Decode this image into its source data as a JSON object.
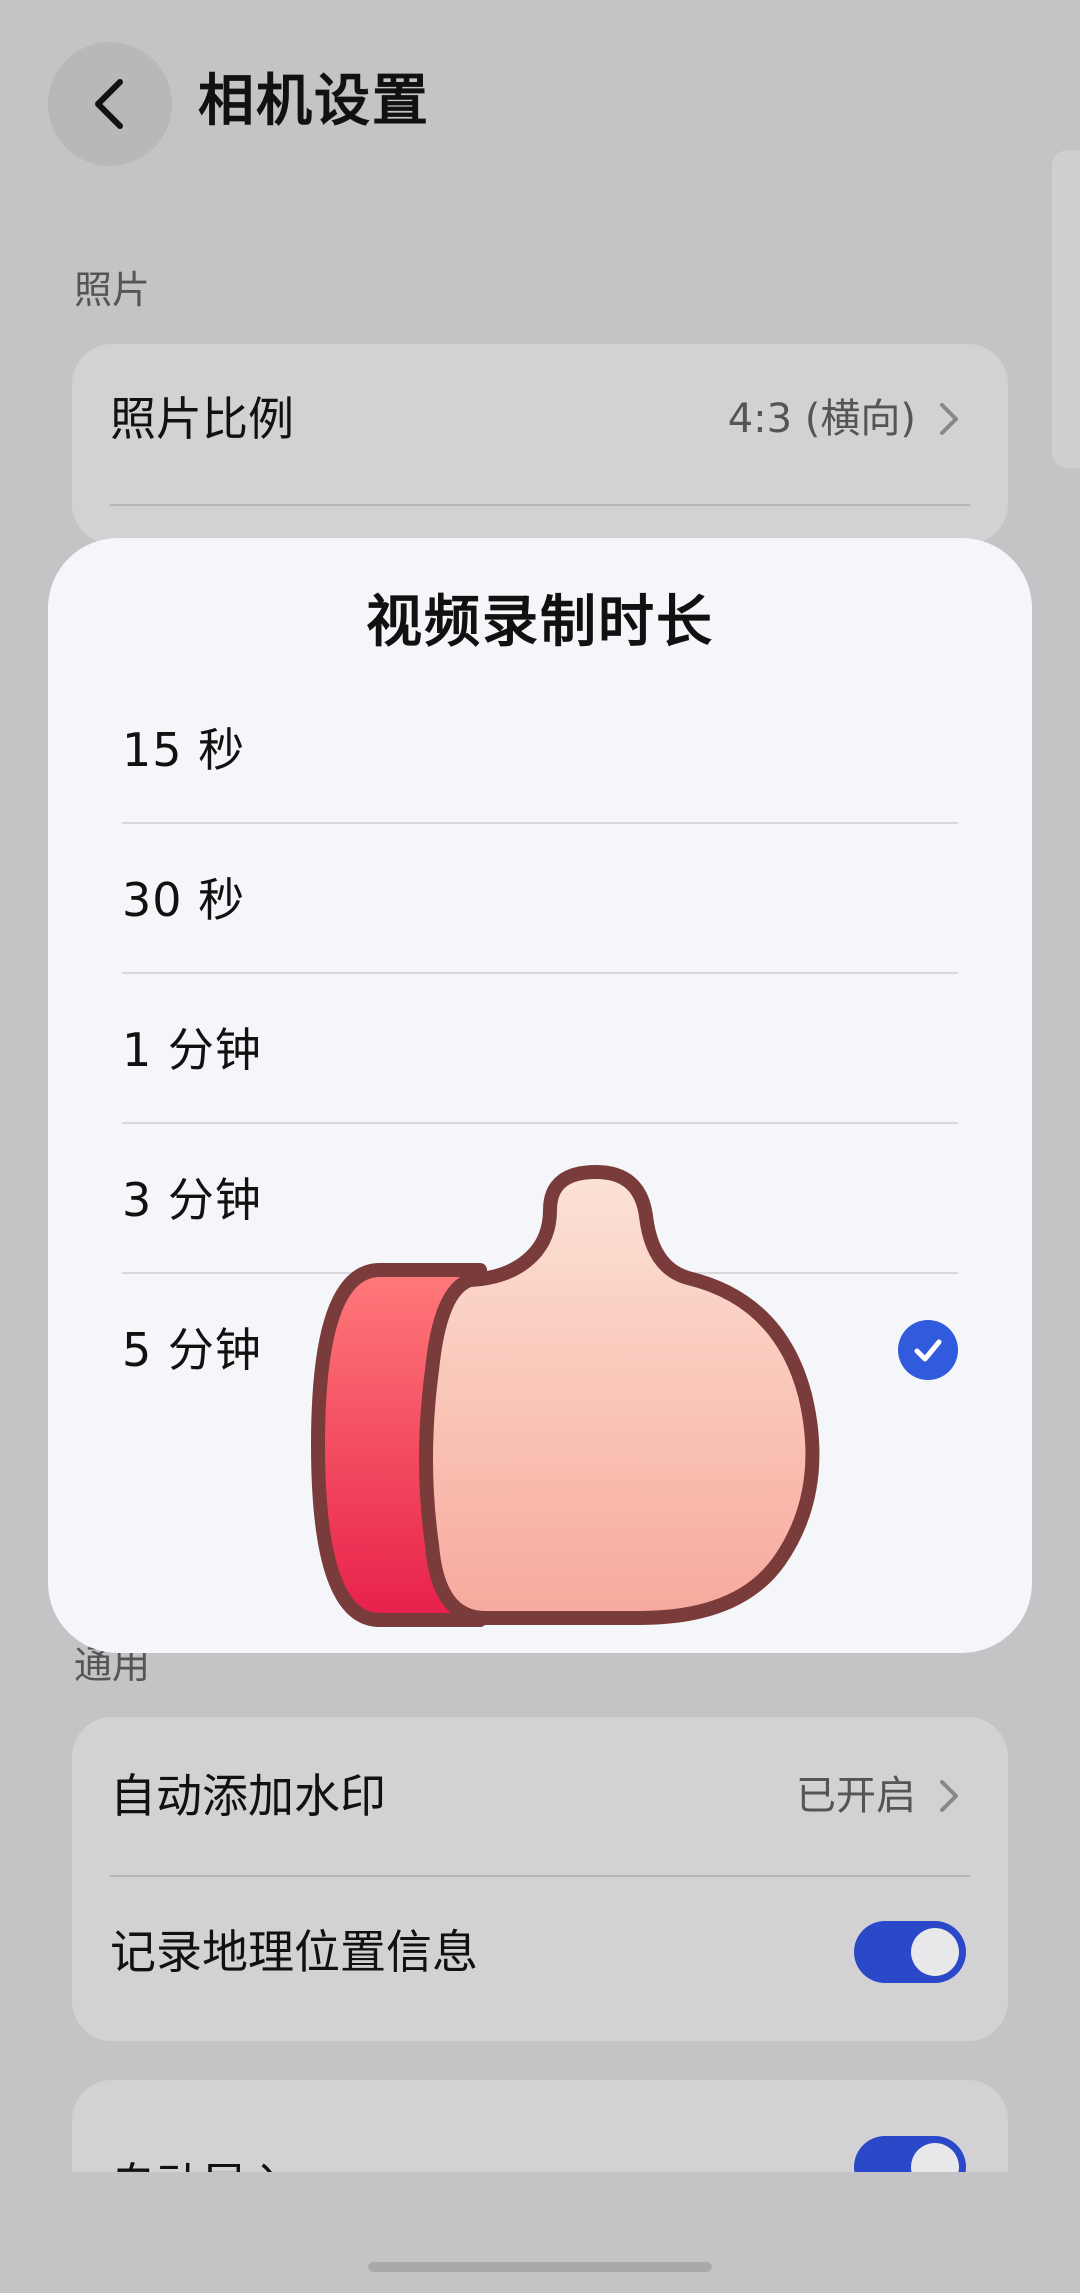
{
  "header": {
    "title": "相机设置"
  },
  "sections": {
    "photo": {
      "label": "照片"
    },
    "general": {
      "label": "通用"
    }
  },
  "photo_card": {
    "ratio": {
      "label": "照片比例",
      "value": "4:3 (横向)"
    }
  },
  "general_card": {
    "watermark": {
      "label": "自动添加水印",
      "value": "已开启"
    },
    "location": {
      "label": "记录地理位置信息",
      "enabled": true
    }
  },
  "import_card": {
    "auto_import": {
      "label": "自动导入",
      "enabled": true
    }
  },
  "dialog": {
    "title": "视频录制时长",
    "options": [
      {
        "label": "15 秒",
        "selected": false
      },
      {
        "label": "30 秒",
        "selected": false
      },
      {
        "label": "1 分钟",
        "selected": false
      },
      {
        "label": "3 分钟",
        "selected": false
      },
      {
        "label": "5 分钟",
        "selected": true
      }
    ]
  },
  "colors": {
    "accent": "#2f5bdc",
    "toggle_on": "#2a48c7",
    "background_dim": "#c4c4c6",
    "dialog_bg": "#f5f6f9"
  },
  "icons": {
    "back": "chevron-left-icon",
    "chevron": "chevron-right-icon",
    "check": "check-circle-icon",
    "overlay": "thumbs-up-icon"
  }
}
